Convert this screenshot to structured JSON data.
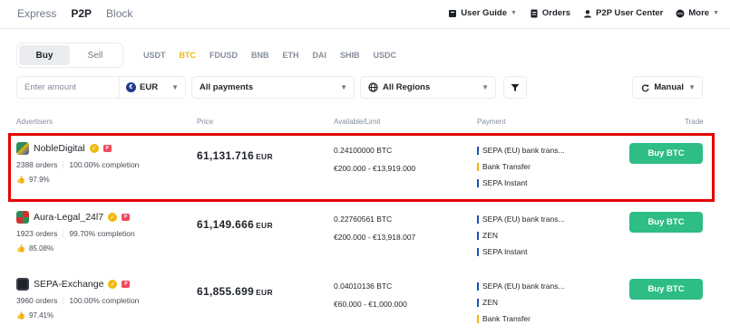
{
  "nav": {
    "tabs": [
      "Express",
      "P2P",
      "Block"
    ],
    "active_tab": "P2P",
    "links": {
      "user_guide": "User Guide",
      "orders": "Orders",
      "user_center": "P2P User Center",
      "more": "More"
    }
  },
  "trade_toggle": {
    "buy": "Buy",
    "sell": "Sell",
    "active": "Buy"
  },
  "assets": [
    "USDT",
    "BTC",
    "FDUSD",
    "BNB",
    "ETH",
    "DAI",
    "SHIB",
    "USDC"
  ],
  "active_asset": "BTC",
  "filters": {
    "amount_placeholder": "Enter amount",
    "currency": "EUR",
    "currency_icon_text": "€",
    "payments": "All payments",
    "regions": "All Regions",
    "sort": "Manual"
  },
  "table_headers": {
    "advertisers": "Advertisers",
    "price": "Price",
    "available": "Available/Limit",
    "payment": "Payment",
    "trade": "Trade"
  },
  "rows": [
    {
      "name": "NobleDigital",
      "orders": "2388 orders",
      "completion": "100.00% completion",
      "rating": "97.9%",
      "price": "61,131.716",
      "price_currency": "EUR",
      "available": "0.24100000 BTC",
      "limit": "€200.000 - €13,919.000",
      "payments": [
        {
          "label": "SEPA (EU) bank trans...",
          "color": "#1e4fb5"
        },
        {
          "label": "Bank Transfer",
          "color": "#f0b90b"
        },
        {
          "label": "SEPA Instant",
          "color": "#1e4fb5"
        }
      ],
      "button": "Buy BTC"
    },
    {
      "name": "Aura-Legal_24l7",
      "orders": "1923 orders",
      "completion": "99.70% completion",
      "rating": "85.08%",
      "price": "61,149.666",
      "price_currency": "EUR",
      "available": "0.22760561 BTC",
      "limit": "€200.000 - €13,918.007",
      "payments": [
        {
          "label": "SEPA (EU) bank trans...",
          "color": "#1e4fb5"
        },
        {
          "label": "ZEN",
          "color": "#1e4fb5"
        },
        {
          "label": "SEPA Instant",
          "color": "#1e4fb5"
        }
      ],
      "button": "Buy BTC"
    },
    {
      "name": "SEPA-Exchange",
      "orders": "3960 orders",
      "completion": "100.00% completion",
      "rating": "97.41%",
      "price": "61,855.699",
      "price_currency": "EUR",
      "available": "0.04010136 BTC",
      "limit": "€60.000 - €1,000.000",
      "payments": [
        {
          "label": "SEPA (EU) bank trans...",
          "color": "#1e4fb5"
        },
        {
          "label": "ZEN",
          "color": "#1e4fb5"
        },
        {
          "label": "Bank Transfer",
          "color": "#f0b90b"
        }
      ],
      "button": "Buy BTC"
    }
  ],
  "icons": {
    "verified": "verified-check-icon",
    "pro_badge": "pro-badge-icon",
    "thumb": "thumbs-up-icon"
  }
}
